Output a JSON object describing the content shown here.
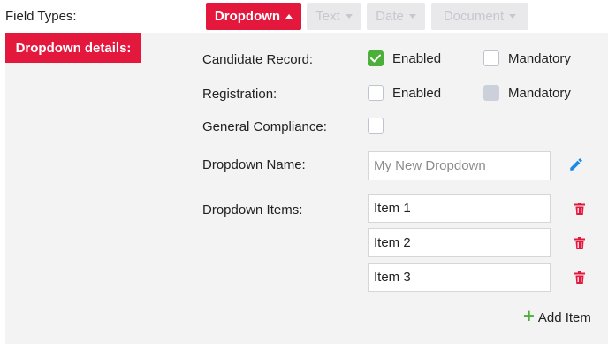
{
  "header": {
    "field_types_label": "Field Types:"
  },
  "field_types": [
    {
      "label": "Dropdown",
      "active": true
    },
    {
      "label": "Text",
      "active": false
    },
    {
      "label": "Date",
      "active": false
    },
    {
      "label": "Document",
      "active": false
    }
  ],
  "panel": {
    "title": "Dropdown details:",
    "candidate_record": {
      "label": "Candidate Record:",
      "enabled_label": "Enabled",
      "enabled": true,
      "mandatory_label": "Mandatory",
      "mandatory": false
    },
    "registration": {
      "label": "Registration:",
      "enabled_label": "Enabled",
      "enabled": false,
      "mandatory_label": "Mandatory",
      "mandatory": false
    },
    "general_compliance": {
      "label": "General Compliance:",
      "checked": false
    },
    "dropdown_name": {
      "label": "Dropdown Name:",
      "placeholder": "My New Dropdown",
      "value": ""
    },
    "dropdown_items": {
      "label": "Dropdown Items:",
      "items": [
        "Item 1",
        "Item 2",
        "Item 3"
      ]
    },
    "add_item_label": "Add Item"
  },
  "colors": {
    "accent": "#e4173d",
    "success": "#4caf3a",
    "edit_icon": "#1e88e5"
  }
}
